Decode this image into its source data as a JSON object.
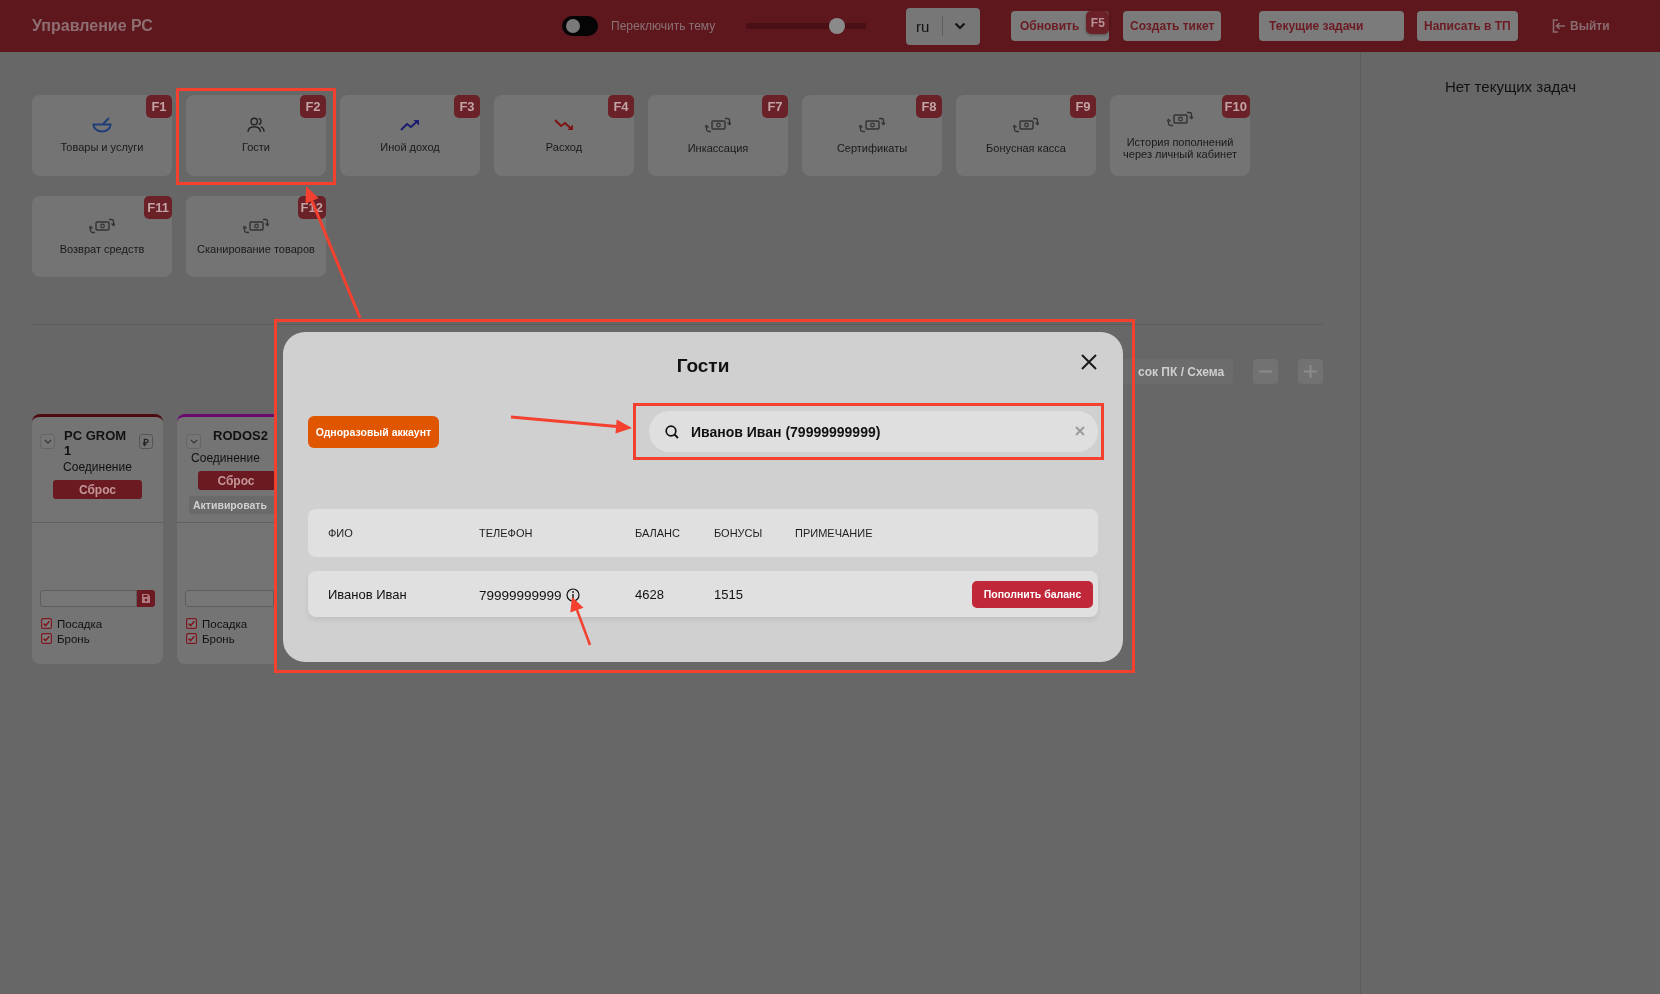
{
  "header": {
    "title": "Управление РС",
    "theme_toggle": {
      "label": "Переключить тему",
      "on": false
    },
    "slider": {
      "level": 0.8
    },
    "language": {
      "value": "ru"
    },
    "buttons": [
      {
        "label": "Обновить",
        "hotkey": "F5",
        "kind": "plain"
      },
      {
        "label": "Создать тикет",
        "kind": "plain"
      },
      {
        "label": "Текущие задачи",
        "kind": "wide"
      },
      {
        "label": "Написать в ТП",
        "kind": "plain"
      }
    ],
    "logout": {
      "label": "Выйти"
    }
  },
  "actions": [
    {
      "label": "Товары и услуги",
      "hotkey": "F1",
      "kind": "goods"
    },
    {
      "label": "Гости",
      "hotkey": "F2",
      "kind": "guests"
    },
    {
      "label": "Иной доход",
      "hotkey": "F3",
      "kind": "income"
    },
    {
      "label": "Расход",
      "hotkey": "F4",
      "kind": "expense"
    },
    {
      "label": "Инкассация",
      "hotkey": "F7",
      "kind": "money"
    },
    {
      "label": "Сертификаты",
      "hotkey": "F8",
      "kind": "money"
    },
    {
      "label": "Бонусная касса",
      "hotkey": "F9",
      "kind": "money"
    },
    {
      "label": "История пополнений через личный кабинет",
      "hotkey": "F10",
      "kind": "money"
    },
    {
      "label": "Возврат средств",
      "hotkey": "F11",
      "kind": "money"
    },
    {
      "label": "Сканирование товаров",
      "hotkey": "F12",
      "kind": "money"
    }
  ],
  "tasks_panel": {
    "empty_text": "Нет текущих задач"
  },
  "pc_toolbar": {
    "view_button": "сок ПК / Схема"
  },
  "pc_cards": [
    {
      "name": "PC GROM 1",
      "color": "#4d0b10",
      "currency": "₽",
      "status": "Соединение",
      "reset_button": "Сброс",
      "checks": [
        {
          "label": "Посадка",
          "checked": true
        },
        {
          "label": "Бронь",
          "checked": true
        }
      ]
    },
    {
      "name": "RODOS2",
      "color": "#6b0a6e",
      "status": "Соединение",
      "reset_button": "Сброс",
      "activate_button": {
        "label": "Активировать",
        "disabled": true
      },
      "checks": [
        {
          "label": "Посадка",
          "checked": true
        },
        {
          "label": "Бронь",
          "checked": true
        }
      ]
    }
  ],
  "guests_modal": {
    "title": "Гости",
    "one_time_button": "Одноразовый аккаунт",
    "search": {
      "value": "Иванов Иван (79999999999)"
    },
    "columns": [
      "ФИО",
      "ТЕЛЕФОН",
      "БАЛАНС",
      "БОНУСЫ",
      "ПРИМЕЧАНИЕ"
    ],
    "rows": [
      {
        "name": "Иванов Иван",
        "phone": "79999999999",
        "balance": "4628",
        "bonuses": "1515",
        "action": "Пополнить баланс"
      }
    ]
  }
}
